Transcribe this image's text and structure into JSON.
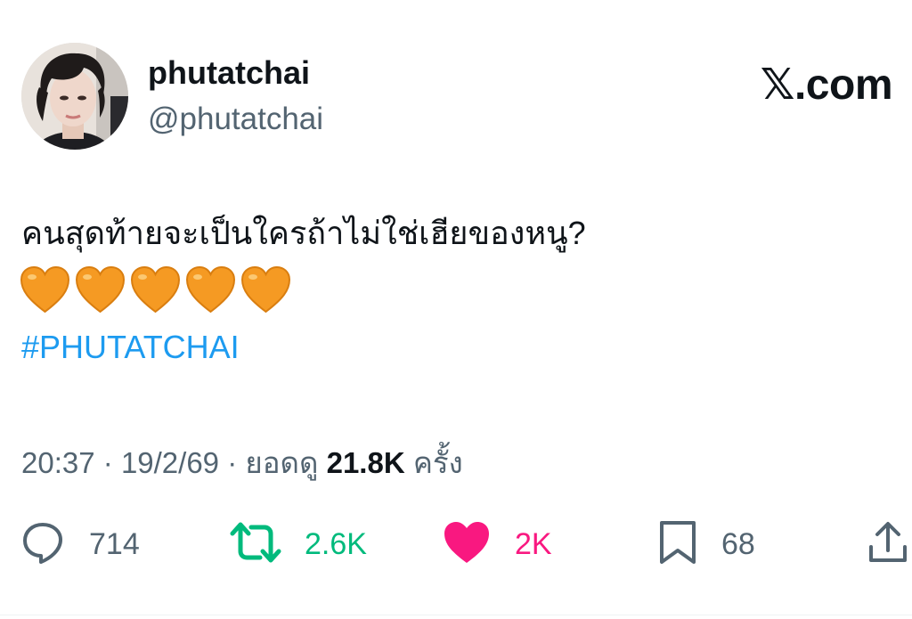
{
  "user": {
    "display_name": "phutatchai",
    "handle": "@phutatchai"
  },
  "brand": {
    "label": "𝕏.com"
  },
  "tweet": {
    "text": "คนสุดท้ายจะเป็นใครถ้าไม่ใช่เฮียของหนู?",
    "emojis": [
      "orange-heart",
      "orange-heart",
      "orange-heart",
      "orange-heart",
      "orange-heart"
    ],
    "hashtag": "#PHUTATCHAI"
  },
  "meta": {
    "time": "20:37",
    "separator": "·",
    "date": "19/2/69",
    "views_label": "ยอดดู",
    "views_count": "21.8K",
    "views_suffix": "ครั้ง"
  },
  "actions": {
    "reply": {
      "icon": "reply-icon",
      "count": "714"
    },
    "retweet": {
      "icon": "retweet-icon",
      "count": "2.6K"
    },
    "like": {
      "icon": "heart-icon",
      "count": "2K"
    },
    "bookmark": {
      "icon": "bookmark-icon",
      "count": "68"
    },
    "share": {
      "icon": "share-icon"
    }
  },
  "colors": {
    "text": "#0f1419",
    "secondary": "#536471",
    "link": "#1d9bf0",
    "retweet": "#00ba7c",
    "like": "#f91880",
    "emoji_heart": "#f59a23"
  }
}
